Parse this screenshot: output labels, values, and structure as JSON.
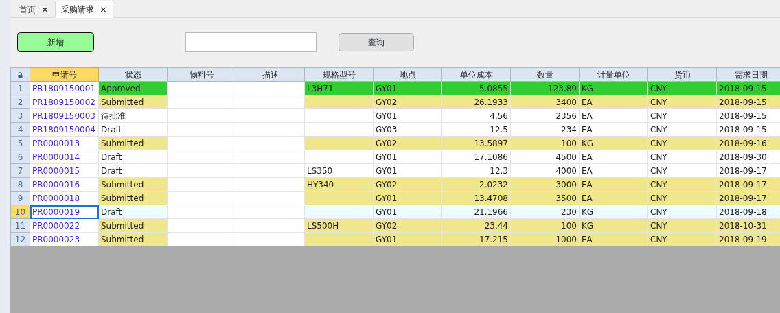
{
  "tabs": [
    {
      "label": "首页",
      "close": "×",
      "selected": false
    },
    {
      "label": "采购请求",
      "close": "×",
      "selected": true
    }
  ],
  "toolbar": {
    "add_button": "新增",
    "query_button": "查询"
  },
  "grid": {
    "columns": [
      {
        "label": "申请号",
        "selected": true
      },
      {
        "label": "状态",
        "selected": false
      },
      {
        "label": "物料号",
        "selected": false
      },
      {
        "label": "描述",
        "selected": false
      },
      {
        "label": "规格型号",
        "selected": false
      },
      {
        "label": "地点",
        "selected": false
      },
      {
        "label": "单位成本",
        "selected": false
      },
      {
        "label": "数量",
        "selected": false
      },
      {
        "label": "计量单位",
        "selected": false
      },
      {
        "label": "货币",
        "selected": false
      },
      {
        "label": "需求日期",
        "selected": false
      }
    ],
    "rows": [
      {
        "number": "1",
        "selected": false,
        "color": "#32cd32",
        "request_no": "PR1809150001",
        "status": "Approved",
        "spec": "L3H71",
        "site": "GY01",
        "unit_cost": "5.0855",
        "quantity": "123.89",
        "unit": "KG",
        "currency": "CNY",
        "required_date": "2018-09-15"
      },
      {
        "number": "2",
        "selected": false,
        "color": "#f0e68c",
        "request_no": "PR1809150002",
        "status": "Submitted",
        "site": "GY02",
        "unit_cost": "26.1933",
        "quantity": "3400",
        "unit": "EA",
        "currency": "CNY",
        "required_date": "2018-09-15"
      },
      {
        "number": "3",
        "selected": false,
        "color": "#ffffff",
        "request_no": "PR1809150003",
        "status": "待批准",
        "site": "GY01",
        "unit_cost": "4.56",
        "quantity": "2356",
        "unit": "EA",
        "currency": "CNY",
        "required_date": "2018-09-15"
      },
      {
        "number": "4",
        "selected": false,
        "color": "#ffffff",
        "request_no": "PR1809150004",
        "status": "Draft",
        "site": "GY03",
        "unit_cost": "12.5",
        "quantity": "234",
        "unit": "EA",
        "currency": "CNY",
        "required_date": "2018-09-15"
      },
      {
        "number": "5",
        "selected": false,
        "color": "#f0e68c",
        "request_no": "PR0000013",
        "status": "Submitted",
        "site": "GY02",
        "unit_cost": "13.5897",
        "quantity": "100",
        "unit": "KG",
        "currency": "CNY",
        "required_date": "2018-09-16"
      },
      {
        "number": "6",
        "selected": false,
        "color": "#ffffff",
        "request_no": "PR0000014",
        "status": "Draft",
        "site": "GY01",
        "unit_cost": "17.1086",
        "quantity": "4500",
        "unit": "EA",
        "currency": "CNY",
        "required_date": "2018-09-30"
      },
      {
        "number": "7",
        "selected": false,
        "color": "#ffffff",
        "request_no": "PR0000015",
        "status": "Draft",
        "spec": "LS350",
        "site": "GY01",
        "unit_cost": "12.3",
        "quantity": "4000",
        "unit": "EA",
        "currency": "CNY",
        "required_date": "2018-09-17"
      },
      {
        "number": "8",
        "selected": false,
        "color": "#f0e68c",
        "request_no": "PR0000016",
        "status": "Submitted",
        "spec": "HY340",
        "site": "GY02",
        "unit_cost": "2.0232",
        "quantity": "3000",
        "unit": "EA",
        "currency": "CNY",
        "required_date": "2018-09-17"
      },
      {
        "number": "9",
        "selected": false,
        "color": "#f0e68c",
        "request_no": "PR0000018",
        "status": "Submitted",
        "site": "GY01",
        "unit_cost": "13.4708",
        "quantity": "3500",
        "unit": "EA",
        "currency": "CNY",
        "required_date": "2018-09-17"
      },
      {
        "number": "10",
        "selected": true,
        "color": "#eefcff",
        "request_no": "PR0000019",
        "status": "Draft",
        "site": "GY01",
        "unit_cost": "21.1966",
        "quantity": "230",
        "unit": "KG",
        "currency": "CNY",
        "required_date": "2018-09-18"
      },
      {
        "number": "11",
        "selected": false,
        "color": "#f0e68c",
        "request_no": "PR0000022",
        "status": "Submitted",
        "spec": "LS500H",
        "site": "GY02",
        "unit_cost": "23.44",
        "quantity": "100",
        "unit": "KG",
        "currency": "CNY",
        "required_date": "2018-10-31"
      },
      {
        "number": "12",
        "selected": false,
        "color": "#f0e68c",
        "request_no": "PR0000023",
        "status": "Submitted",
        "site": "GY01",
        "unit_cost": "17.215",
        "quantity": "1000",
        "unit": "EA",
        "currency": "CNY",
        "required_date": "2018-09-19"
      }
    ]
  }
}
